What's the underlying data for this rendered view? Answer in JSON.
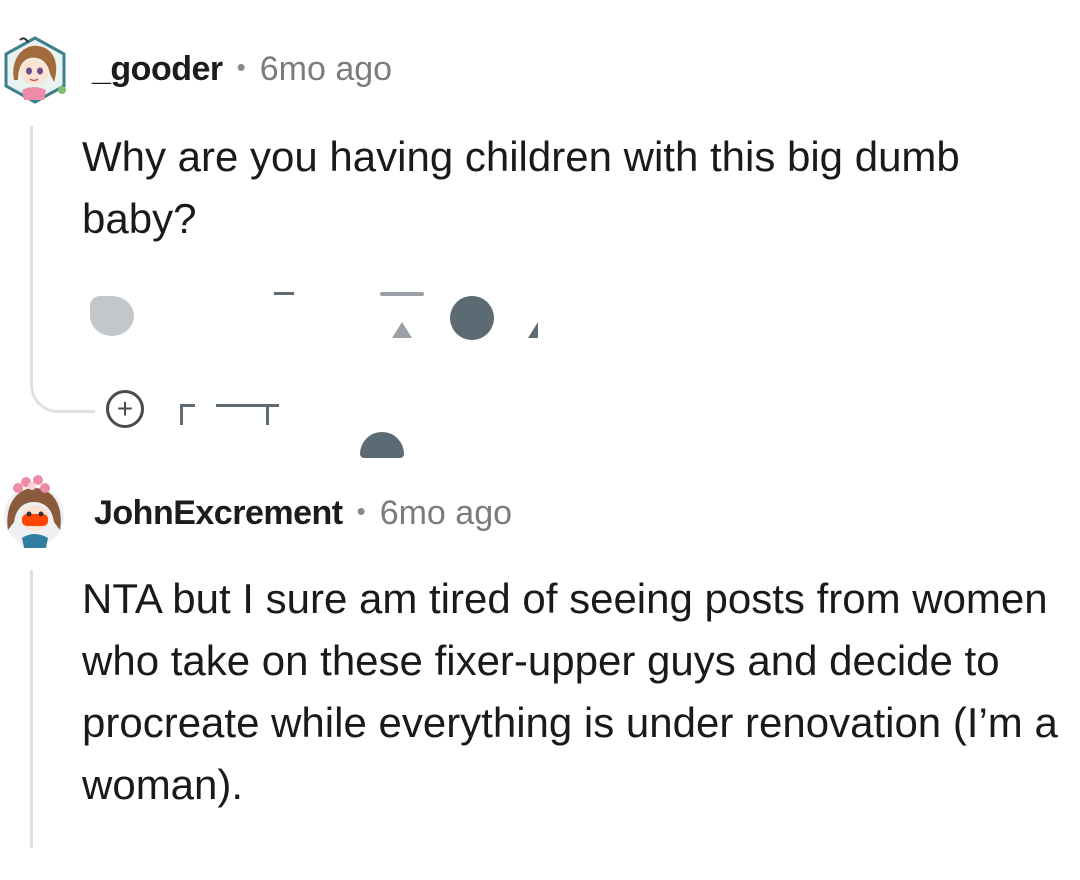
{
  "comments": [
    {
      "username": "_gooder",
      "separator": "•",
      "timestamp": "6mo ago",
      "avatar": "anime-girl-avatar",
      "lines": [
        "Why are you having children with this big dumb",
        "baby?"
      ]
    },
    {
      "username": "JohnExcrement",
      "separator": "•",
      "timestamp": "6mo ago",
      "avatar": "flower-hair-avatar",
      "lines": [
        "NTA but I sure am tired of seeing posts from women",
        "who take on these fixer-upper guys and decide to",
        "procreate while everything is under renovation (I’m a",
        "woman)."
      ]
    }
  ],
  "icons": {
    "more_replies": "plus-circle-icon",
    "reply": "reply-icon",
    "upvote": "upvote-icon",
    "award": "award-icon"
  },
  "colors": {
    "thread_line": "#e0e0e0",
    "meta_gray": "#7c7c7c",
    "text": "#1a1a1b"
  }
}
